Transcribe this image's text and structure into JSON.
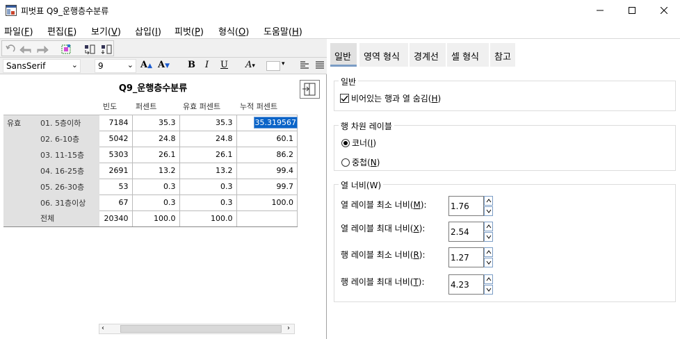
{
  "window": {
    "title": "피벗표 Q9_운행층수분류"
  },
  "menu": [
    {
      "label": "파일(",
      "key": "F",
      "tail": ")"
    },
    {
      "label": "편집(",
      "key": "E",
      "tail": ")"
    },
    {
      "label": "보기(",
      "key": "V",
      "tail": ")"
    },
    {
      "label": "삽입(",
      "key": "I",
      "tail": ")"
    },
    {
      "label": "피벗(",
      "key": "P",
      "tail": ")"
    },
    {
      "label": "형식(",
      "key": "O",
      "tail": ")"
    },
    {
      "label": "도움말(",
      "key": "H",
      "tail": ")"
    }
  ],
  "format_toolbar": {
    "font_family": "SansSerif",
    "font_size": "9"
  },
  "pivot": {
    "title": "Q9_운행층수분류",
    "columns": [
      "빈도",
      "퍼센트",
      "유효 퍼센트",
      "누적 퍼센트"
    ],
    "group_label": "유효",
    "rows": [
      {
        "label": "01. 5층이하",
        "freq": "7184",
        "pct": "35.3",
        "valid": "35.3",
        "cum": "35.319567"
      },
      {
        "label": "02. 6-10층",
        "freq": "5042",
        "pct": "24.8",
        "valid": "24.8",
        "cum": "60.1"
      },
      {
        "label": "03. 11-15층",
        "freq": "5303",
        "pct": "26.1",
        "valid": "26.1",
        "cum": "86.2"
      },
      {
        "label": "04. 16-25층",
        "freq": "2691",
        "pct": "13.2",
        "valid": "13.2",
        "cum": "99.4"
      },
      {
        "label": "05. 26-30층",
        "freq": "53",
        "pct": "0.3",
        "valid": "0.3",
        "cum": "99.7"
      },
      {
        "label": "06. 31층이상",
        "freq": "67",
        "pct": "0.3",
        "valid": "0.3",
        "cum": "100.0"
      },
      {
        "label": "전체",
        "freq": "20340",
        "pct": "100.0",
        "valid": "100.0",
        "cum": ""
      }
    ]
  },
  "panel": {
    "tabs": [
      "일반",
      "영역 형식",
      "경계선",
      "셀 형식",
      "참고"
    ],
    "general": {
      "legend": "일반",
      "hide_empty": {
        "label": "비어있는 행과 열 숨김(",
        "key": "H",
        "tail": ")",
        "checked": true
      }
    },
    "row_dim": {
      "legend": "행 차원 레이블",
      "corner": {
        "label": "코너(",
        "key": "I",
        "tail": ")",
        "selected": true
      },
      "nested": {
        "label": "중첩(",
        "key": "N",
        "tail": ")",
        "selected": false
      }
    },
    "col_width": {
      "legend": "열 너비(W)",
      "fields": [
        {
          "label": "열 레이블 최소 너비(",
          "key": "M",
          "tail": "):",
          "value": "1.76"
        },
        {
          "label": "열 레이블 최대 너비(",
          "key": "X",
          "tail": "):",
          "value": "2.54"
        },
        {
          "label": "행 레이블 최소 너비(",
          "key": "R",
          "tail": "):",
          "value": "1.27"
        },
        {
          "label": "행 레이블 최대 너비(",
          "key": "T",
          "tail": "):",
          "value": "4.23"
        }
      ]
    }
  },
  "colors": {
    "selection": "#0a64c8",
    "label_bg": "#e1e1e1",
    "tab_active": "#e1e1e1"
  }
}
